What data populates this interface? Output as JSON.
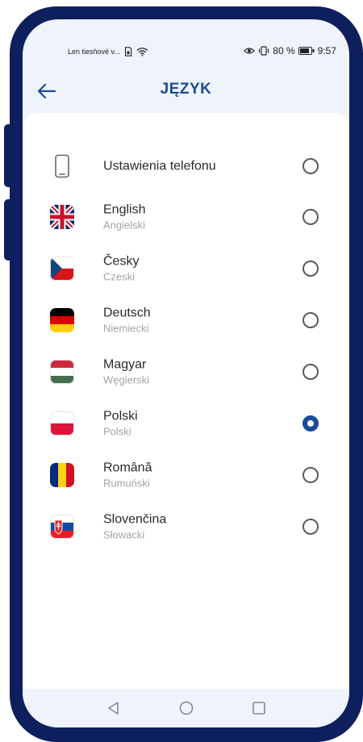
{
  "status_bar": {
    "carrier": "Len tiesňové v...",
    "battery_percent": "80 %",
    "time": "9:57",
    "icons": [
      "sim-icon",
      "wifi-icon",
      "eye-icon",
      "vibrate-icon",
      "battery-icon"
    ]
  },
  "header": {
    "title": "JĘZYK",
    "back_icon": "arrow-left-icon"
  },
  "languages": [
    {
      "name": "Ustawienia telefonu",
      "subtitle": "",
      "icon": "phone-icon",
      "selected": false
    },
    {
      "name": "English",
      "subtitle": "Angielski",
      "icon": "flag-uk-icon",
      "selected": false
    },
    {
      "name": "Česky",
      "subtitle": "Czeski",
      "icon": "flag-cz-icon",
      "selected": false
    },
    {
      "name": "Deutsch",
      "subtitle": "Niemiecki",
      "icon": "flag-de-icon",
      "selected": false
    },
    {
      "name": "Magyar",
      "subtitle": "Węgierski",
      "icon": "flag-hu-icon",
      "selected": false
    },
    {
      "name": "Polski",
      "subtitle": "Polski",
      "icon": "flag-pl-icon",
      "selected": true
    },
    {
      "name": "Română",
      "subtitle": "Rumuński",
      "icon": "flag-ro-icon",
      "selected": false
    },
    {
      "name": "Slovenčina",
      "subtitle": "Słowacki",
      "icon": "flag-sk-icon",
      "selected": false
    }
  ],
  "navigation": {
    "icons": [
      "back-triangle-icon",
      "home-circle-icon",
      "recents-square-icon"
    ]
  },
  "colors": {
    "accent": "#1b4c96",
    "frame": "#0d1f5c",
    "screen_background": "#eef3fc"
  }
}
